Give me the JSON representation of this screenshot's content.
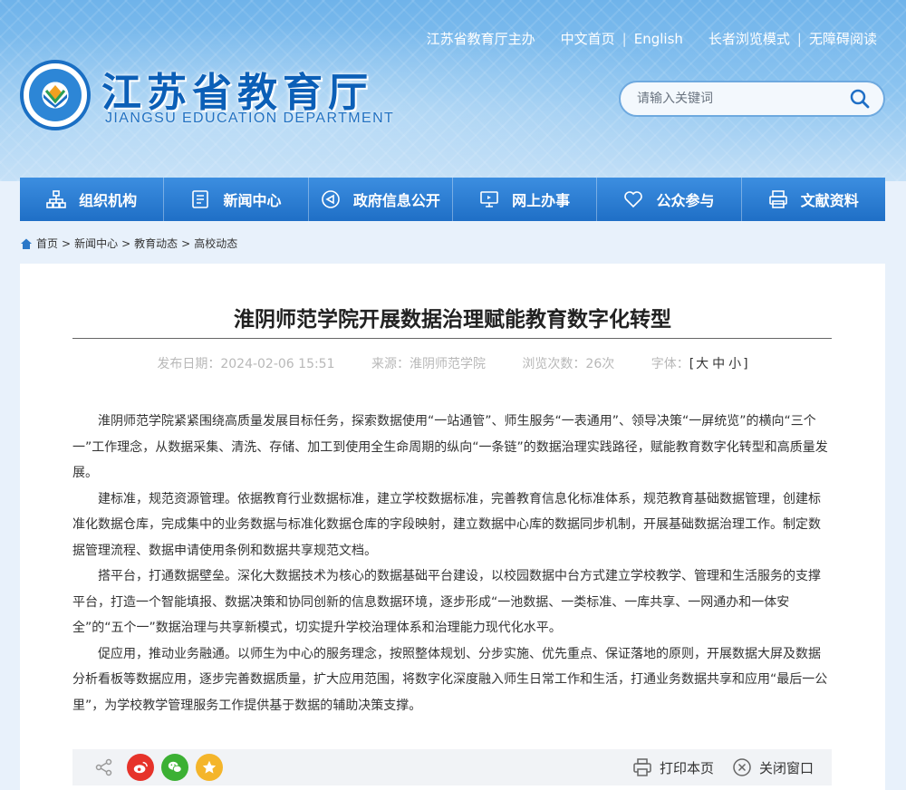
{
  "header": {
    "links": {
      "sponsor": "江苏省教育厅主办",
      "home_cn": "中文首页",
      "english": "English",
      "elder_mode": "长者浏览模式",
      "accessibility": "无障碍阅读"
    },
    "site_title": "江苏省教育厅",
    "site_subtitle": "JIANGSU EDUCATION DEPARTMENT",
    "search_placeholder": "请输入关键词"
  },
  "nav": {
    "items": [
      {
        "label": "组织机构",
        "icon": "org-chart-icon"
      },
      {
        "label": "新闻中心",
        "icon": "document-icon"
      },
      {
        "label": "政府信息公开",
        "icon": "speaker-icon"
      },
      {
        "label": "网上办事",
        "icon": "monitor-icon"
      },
      {
        "label": "公众参与",
        "icon": "heart-icon"
      },
      {
        "label": "文献资料",
        "icon": "printer-icon"
      }
    ]
  },
  "breadcrumb": {
    "home": "首页",
    "level1": "新闻中心",
    "level2": "教育动态",
    "level3": "高校动态",
    "separator": ">"
  },
  "article": {
    "title": "淮阴师范学院开展数据治理赋能教育数字化转型",
    "publish_label": "发布日期：",
    "publish_date": "2024-02-06 15:51",
    "source_label": "来源：",
    "source": "淮阴师范学院",
    "views_label": "浏览次数：",
    "views": "26次",
    "font_label": "字体：",
    "font_large": "大",
    "font_medium": "中",
    "font_small": "小",
    "paragraphs": [
      "淮阴师范学院紧紧围绕高质量发展目标任务，探索数据使用“一站通管”、师生服务“一表通用”、领导决策“一屏统览”的横向“三个一”工作理念，从数据采集、清洗、存储、加工到使用全生命周期的纵向“一条链”的数据治理实践路径，赋能教育数字化转型和高质量发展。",
      "建标准，规范资源管理。依据教育行业数据标准，建立学校数据标准，完善教育信息化标准体系，规范教育基础数据管理，创建标准化数据仓库，完成集中的业务数据与标准化数据仓库的字段映射，建立数据中心库的数据同步机制，开展基础数据治理工作。制定数据管理流程、数据申请使用条例和数据共享规范文档。",
      "搭平台，打通数据壁垒。深化大数据技术为核心的数据基础平台建设，以校园数据中台方式建立学校教学、管理和生活服务的支撑平台，打造一个智能填报、数据决策和协同创新的信息数据环境，逐步形成“一池数据、一类标准、一库共享、一网通办和一体安全”的“五个一”数据治理与共享新模式，切实提升学校治理体系和治理能力现代化水平。",
      "促应用，推动业务融通。以师生为中心的服务理念，按照整体规划、分步实施、优先重点、保证落地的原则，开展数据大屏及数据分析看板等数据应用，逐步完善数据质量，扩大应用范围，将数字化深度融入师生日常工作和生活，打通业务数据共享和应用“最后一公里”，为学校教学管理服务工作提供基于数据的辅助决策支撑。"
    ]
  },
  "share": {
    "print_label": "打印本页",
    "close_label": "关闭窗口"
  },
  "colors": {
    "nav_blue": "#1f6fc6",
    "title_blue": "#0b5fb7",
    "weibo": "#e6332a",
    "wechat": "#3cb034",
    "qzone": "#f4b52b"
  }
}
